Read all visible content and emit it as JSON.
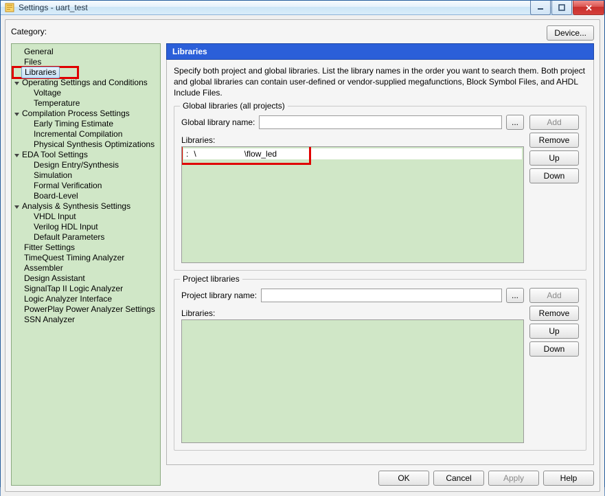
{
  "window": {
    "title": "Settings - uart_test"
  },
  "category_label": "Category:",
  "device_button": "Device...",
  "tree": {
    "general": "General",
    "files": "Files",
    "libraries": "Libraries",
    "opset": "Operating Settings and Conditions",
    "voltage": "Voltage",
    "temperature": "Temperature",
    "comp": "Compilation Process Settings",
    "ete": "Early Timing Estimate",
    "inc": "Incremental Compilation",
    "pso": "Physical Synthesis Optimizations",
    "eda": "EDA Tool Settings",
    "des": "Design Entry/Synthesis",
    "sim": "Simulation",
    "fv": "Formal Verification",
    "bl": "Board-Level",
    "ans": "Analysis & Synthesis Settings",
    "vhdl": "VHDL Input",
    "veri": "Verilog HDL Input",
    "dp": "Default Parameters",
    "fitter": "Fitter Settings",
    "tq": "TimeQuest Timing Analyzer",
    "asm": "Assembler",
    "da": "Design Assistant",
    "st": "SignalTap II Logic Analyzer",
    "lai": "Logic Analyzer Interface",
    "ppa": "PowerPlay Power Analyzer Settings",
    "ssn": "SSN Analyzer"
  },
  "page": {
    "title": "Libraries",
    "description": "Specify both project and global libraries. List the library names in the order you want to search them. Both project and global libraries can contain user-defined or vendor-supplied megafunctions, Block Symbol Files, and AHDL Include Files."
  },
  "global": {
    "legend": "Global libraries (all projects)",
    "name_label": "Global library name:",
    "name_value": "",
    "list_label": "Libraries:",
    "entry_visible_suffix": "\\flow_led"
  },
  "project": {
    "legend": "Project libraries",
    "name_label": "Project library name:",
    "name_value": "",
    "list_label": "Libraries:"
  },
  "side_buttons": {
    "add": "Add",
    "remove": "Remove",
    "up": "Up",
    "down": "Down"
  },
  "browse_label": "...",
  "bottom": {
    "ok": "OK",
    "cancel": "Cancel",
    "apply": "Apply",
    "help": "Help"
  }
}
